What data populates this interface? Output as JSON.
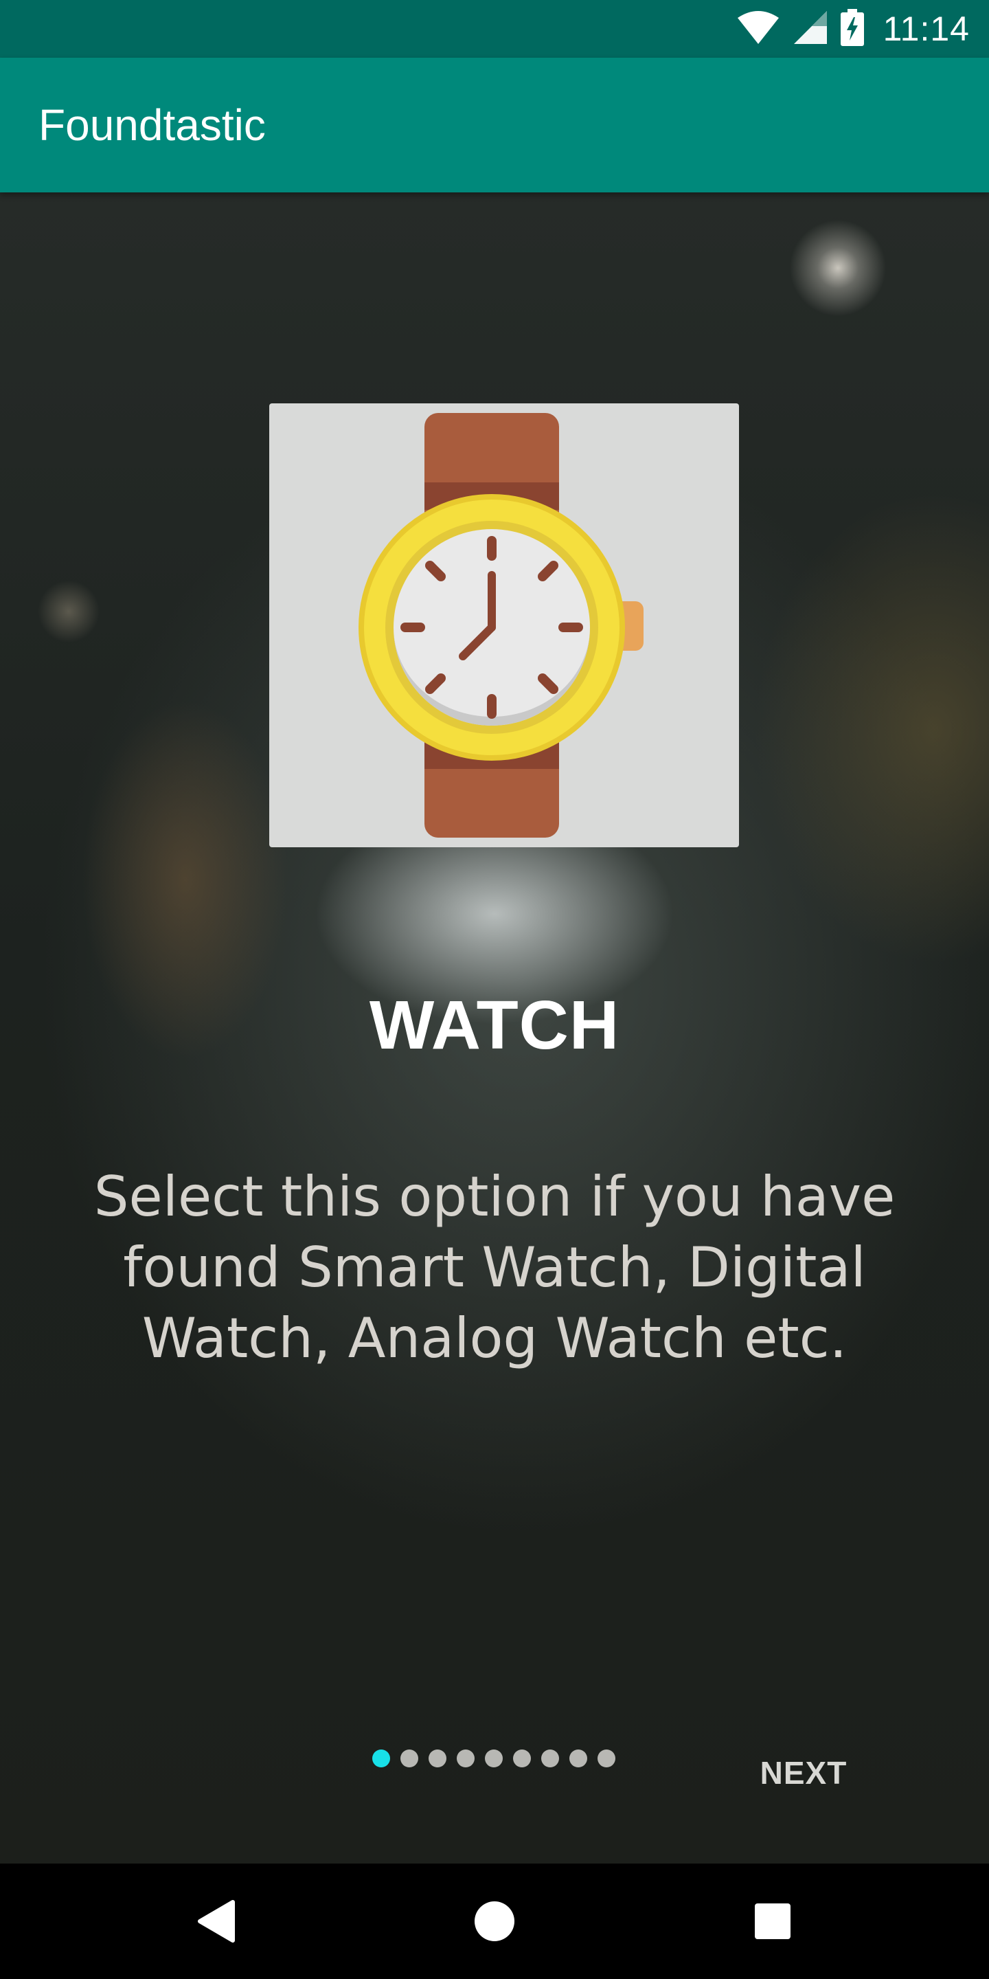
{
  "status_bar": {
    "time": "11:14",
    "icons": [
      "wifi-icon",
      "cellular-signal-icon",
      "battery-charging-icon"
    ]
  },
  "app_bar": {
    "title": "Foundtastic",
    "background_color": "#00897b",
    "status_color": "#00695f"
  },
  "slide": {
    "image": "watch-illustration",
    "title": "WATCH",
    "description": "Select this option if you have found Smart Watch, Digital Watch, Analog Watch etc."
  },
  "pager": {
    "total_pages": 9,
    "current_page": 1,
    "active_dot_color": "#18e0e8",
    "next_label": "NEXT"
  },
  "nav_bar": {
    "buttons": [
      "back-icon",
      "home-icon",
      "recents-icon"
    ]
  }
}
